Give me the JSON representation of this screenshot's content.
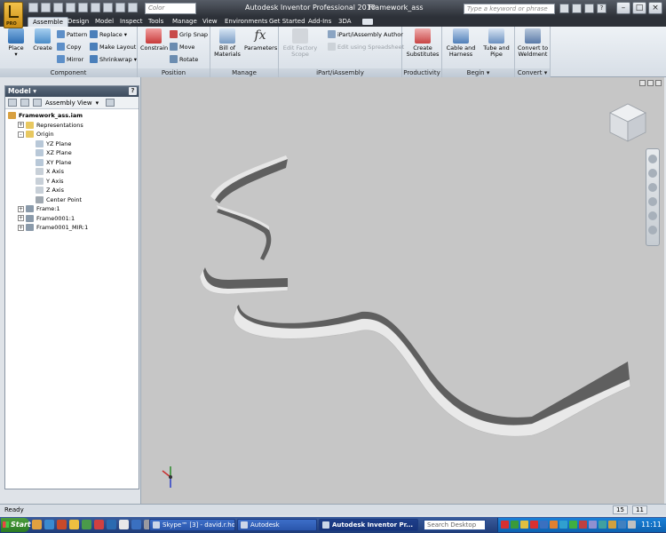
{
  "titlebar": {
    "color_value": "Color",
    "title": "Autodesk Inventor Professional 2010",
    "filename": "Framework_ass",
    "search_placeholder": "Type a keyword or phrase",
    "logo_badge": "PRO"
  },
  "tabs": [
    "Assemble",
    "Design",
    "Model",
    "Inspect",
    "Tools",
    "Manage",
    "View",
    "Environments",
    "Get Started",
    "Add-Ins",
    "3DA"
  ],
  "active_tab": "Assemble",
  "ribbon": {
    "component": {
      "label": "Component",
      "place": "Place",
      "create": "Create",
      "pattern": "Pattern",
      "copy": "Copy",
      "mirror": "Mirror",
      "replace": "Replace",
      "make_layout": "Make Layout",
      "shrinkwrap": "Shrinkwrap"
    },
    "position": {
      "label": "Position",
      "constrain": "Constrain",
      "grip_snap": "Grip Snap",
      "move": "Move",
      "rotate": "Rotate"
    },
    "manage": {
      "label": "Manage",
      "bom_line1": "Bill of",
      "bom_line2": "Materials",
      "parameters": "Parameters"
    },
    "ipart": {
      "label": "iPart/iAssembly",
      "edit_factory_line1": "Edit Factory",
      "edit_factory_line2": "Scope",
      "author": "iPart/iAssembly Author",
      "edit_spreadsheet": "Edit using Spreadsheet"
    },
    "productivity": {
      "label": "Productivity",
      "create_line1": "Create",
      "create_line2": "Substitutes"
    },
    "begin": {
      "label": "Begin",
      "cable_line1": "Cable and",
      "cable_line2": "Harness",
      "tube_line1": "Tube and",
      "tube_line2": "Pipe"
    },
    "convert": {
      "label": "Convert",
      "line1": "Convert to",
      "line2": "Weldment"
    }
  },
  "browser": {
    "title": "Model",
    "help": "?",
    "view_selector": "Assembly View",
    "tree": [
      {
        "label": "Framework_ass.iam",
        "indent": 0,
        "expander": "",
        "icon": "assembly-icon"
      },
      {
        "label": "Representations",
        "indent": 1,
        "expander": "+",
        "icon": "folder-icon"
      },
      {
        "label": "Origin",
        "indent": 1,
        "expander": "-",
        "icon": "folder-icon"
      },
      {
        "label": "YZ Plane",
        "indent": 2,
        "expander": "",
        "icon": "plane-icon"
      },
      {
        "label": "XZ Plane",
        "indent": 2,
        "expander": "",
        "icon": "plane-icon"
      },
      {
        "label": "XY Plane",
        "indent": 2,
        "expander": "",
        "icon": "plane-icon"
      },
      {
        "label": "X Axis",
        "indent": 2,
        "expander": "",
        "icon": "axis-icon"
      },
      {
        "label": "Y Axis",
        "indent": 2,
        "expander": "",
        "icon": "axis-icon"
      },
      {
        "label": "Z Axis",
        "indent": 2,
        "expander": "",
        "icon": "axis-icon"
      },
      {
        "label": "Center Point",
        "indent": 2,
        "expander": "",
        "icon": "point-icon"
      },
      {
        "label": "Frame:1",
        "indent": 1,
        "expander": "+",
        "icon": "part-icon"
      },
      {
        "label": "Frame0001:1",
        "indent": 1,
        "expander": "+",
        "icon": "part-icon"
      },
      {
        "label": "Frame0001_MIR:1",
        "indent": 1,
        "expander": "+",
        "icon": "part-icon"
      }
    ]
  },
  "status": {
    "text": "Ready",
    "num1": "15",
    "num2": "11"
  },
  "taskbar": {
    "start": "Start",
    "tasks": [
      "Skype™ [3] - david.r.ho...",
      "Autodesk",
      "Autodesk Inventor Pr..."
    ],
    "search_placeholder": "Search Desktop",
    "clock": "11:11"
  },
  "colors": {
    "titlebar": "#2d3138",
    "viewport_bg": "#c6c6c6",
    "part_dark": "#5f5f5f",
    "part_light": "#eaeaea"
  }
}
